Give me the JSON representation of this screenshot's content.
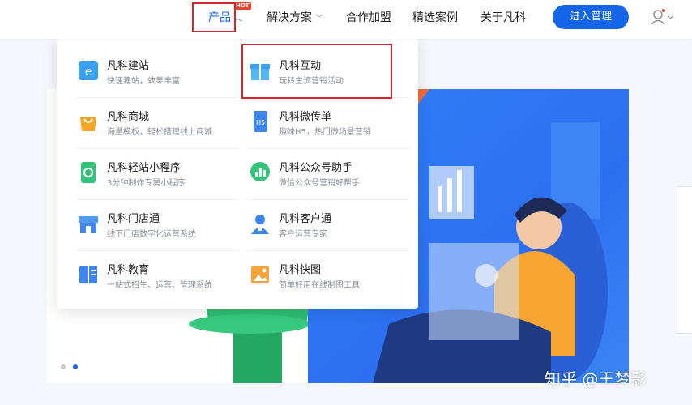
{
  "nav": {
    "products": "产品",
    "hot_badge": "HOT",
    "solutions": "解决方案",
    "partners": "合作加盟",
    "cases": "精选案例",
    "about": "关于凡科",
    "cta": "进入管理"
  },
  "menu": {
    "left": [
      {
        "title": "凡科建站",
        "desc": "快速建站，效果丰富",
        "icon": "website-icon"
      },
      {
        "title": "凡科商城",
        "desc": "海量模板，轻松搭建线上商城",
        "icon": "shopping-bag-icon"
      },
      {
        "title": "凡科轻站小程序",
        "desc": "3分钟制作专属小程序",
        "icon": "mini-program-icon"
      },
      {
        "title": "凡科门店通",
        "desc": "线下门店数字化运营系统",
        "icon": "store-icon"
      },
      {
        "title": "凡科教育",
        "desc": "一站式招生、运营、管理系统",
        "icon": "education-book-icon"
      }
    ],
    "right": [
      {
        "title": "凡科互动",
        "desc": "玩转主流营销活动",
        "icon": "gift-icon"
      },
      {
        "title": "凡科微传单",
        "desc": "趣味H5，热门微场景营销",
        "icon": "h5-flyer-icon"
      },
      {
        "title": "凡科公众号助手",
        "desc": "微信公众号营销好帮手",
        "icon": "chat-chart-icon"
      },
      {
        "title": "凡科客户通",
        "desc": "客户运营专家",
        "icon": "customer-icon"
      },
      {
        "title": "凡科快图",
        "desc": "简单好用在线制图工具",
        "icon": "image-design-icon"
      }
    ]
  },
  "watermark": "知乎 @王梦影",
  "colors": {
    "brand_blue": "#1465e8",
    "highlight_red": "#d9242b",
    "hero_blue": "#2f80f8"
  }
}
